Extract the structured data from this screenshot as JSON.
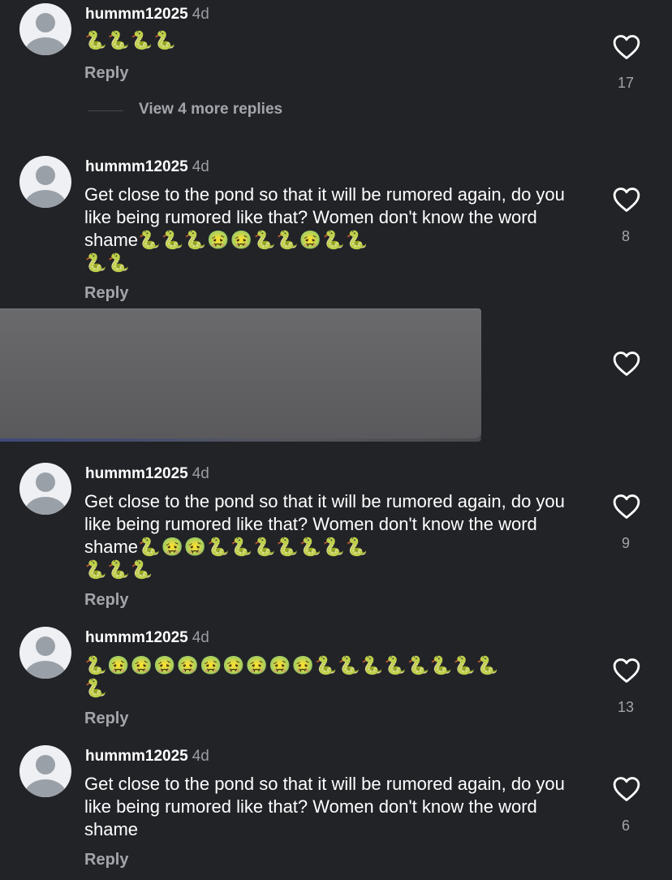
{
  "comments": [
    {
      "username": "hummm12025",
      "time": "4d",
      "text": "",
      "emojis": "🐍🐍🐍🐍",
      "emojis2": "",
      "reply": "Reply",
      "likes": "17",
      "view_more": "View 4 more replies"
    },
    {
      "username": "hummm12025",
      "time": "4d",
      "text": "Get close to the pond so that it will be rumored again, do you like being rumored like that? Women don't know the word shame",
      "emojis": "🐍🐍🐍🤢🤢🐍🐍🤢🐍🐍",
      "emojis2": "🐍🐍",
      "reply": "Reply",
      "likes": "8"
    },
    {
      "username": "hummm12025",
      "time": "4d",
      "text": "Get close to the pond so that it will be rumored again, do you like being rumored like that? Women don't know the word shame",
      "emojis": "🐍🤢🤢🐍🐍🐍🐍🐍🐍🐍",
      "emojis2": "🐍🐍🐍",
      "reply": "Reply",
      "likes": "9"
    },
    {
      "username": "hummm12025",
      "time": "4d",
      "text": "",
      "emojis": "🐍🤢🤢🤢🤢🤢🤢🤢🤢🤢🐍🐍🐍🐍🐍🐍🐍🐍",
      "emojis2": "🐍",
      "reply": "Reply",
      "likes": "13"
    },
    {
      "username": "hummm12025",
      "time": "4d",
      "text": "Get close to the pond so that it will be rumored again, do you like being rumored like that? Women don't know the word shame",
      "emojis": "",
      "emojis2": "",
      "reply": "Reply",
      "likes": "6"
    }
  ],
  "icons": {
    "like": "heart-outline-icon",
    "avatar": "default-avatar-icon"
  },
  "colors": {
    "background": "#222327",
    "text": "#ffffff",
    "secondary": "#a3a5ab"
  }
}
